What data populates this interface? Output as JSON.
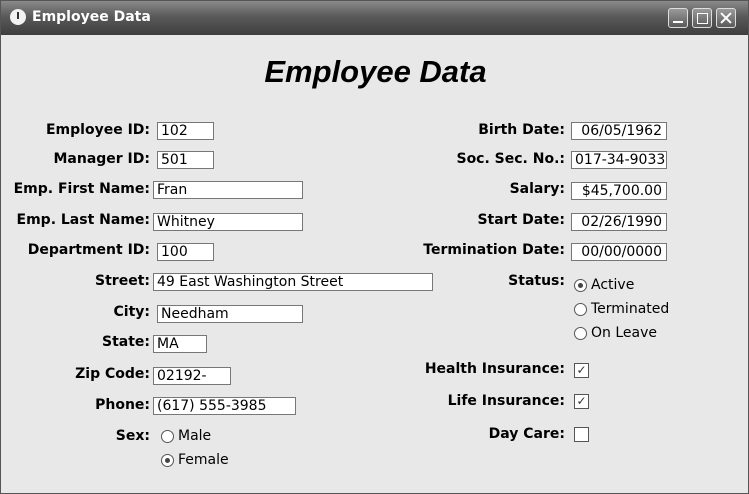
{
  "window": {
    "title": "Employee Data"
  },
  "form": {
    "heading": "Employee Data",
    "left": {
      "employee_id": {
        "label": "Employee ID:",
        "value": "102"
      },
      "manager_id": {
        "label": "Manager ID:",
        "value": "501"
      },
      "first_name": {
        "label": "Emp. First Name:",
        "value": "Fran"
      },
      "last_name": {
        "label": "Emp. Last Name:",
        "value": "Whitney"
      },
      "department_id": {
        "label": "Department ID:",
        "value": "100"
      },
      "street": {
        "label": "Street:",
        "value": "49 East Washington Street"
      },
      "city": {
        "label": "City:",
        "value": "Needham"
      },
      "state": {
        "label": "State:",
        "value": "MA"
      },
      "zip": {
        "label": "Zip Code:",
        "value": "02192-"
      },
      "phone": {
        "label": "Phone:",
        "value": "(617) 555-3985"
      },
      "sex": {
        "label": "Sex:",
        "options": [
          "Male",
          "Female"
        ],
        "selected": "Female"
      }
    },
    "right": {
      "birth_date": {
        "label": "Birth Date:",
        "value": "06/05/1962"
      },
      "ssn": {
        "label": "Soc. Sec. No.:",
        "value": "017-34-9033"
      },
      "salary": {
        "label": "Salary:",
        "value": "$45,700.00"
      },
      "start_date": {
        "label": "Start Date:",
        "value": "02/26/1990"
      },
      "termination_date": {
        "label": "Termination Date:",
        "value": "00/00/0000"
      },
      "status": {
        "label": "Status:",
        "options": [
          "Active",
          "Terminated",
          "On Leave"
        ],
        "selected": "Active"
      },
      "health_insurance": {
        "label": "Health Insurance:",
        "checked": true
      },
      "life_insurance": {
        "label": "Life Insurance:",
        "checked": true
      },
      "day_care": {
        "label": "Day Care:",
        "checked": false
      }
    }
  }
}
